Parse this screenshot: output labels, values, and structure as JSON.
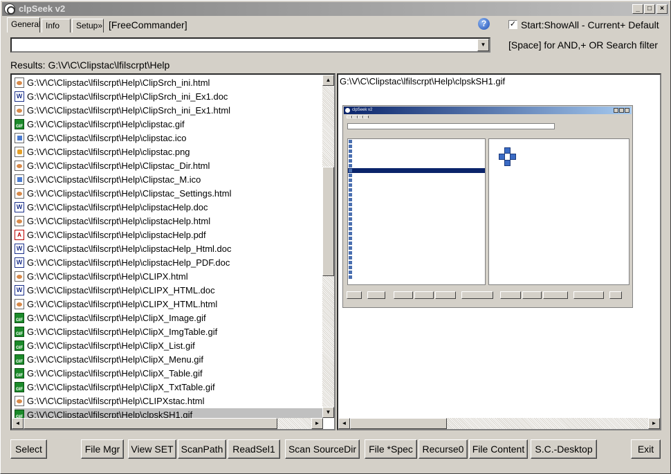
{
  "window": {
    "title": "clpSeek v2",
    "controls": {
      "minimize": "_",
      "maximize": "□",
      "close": "×"
    }
  },
  "tabs": [
    {
      "label": "General",
      "active": true
    },
    {
      "label": "Info",
      "active": false
    },
    {
      "label": "Setup»",
      "active": false
    }
  ],
  "freecommander_label": "[FreeCommander]",
  "help_icon": "?",
  "show_all": {
    "checked": true,
    "mark": "✓",
    "label": "Start:ShowAll - Current+ Default"
  },
  "search": {
    "value": "",
    "placeholder": "",
    "dropdown_glyph": "▼"
  },
  "filter_hint": "[Space] for AND,+ OR Search filter",
  "results_label": "Results: G:\\V\\C\\Clipstac\\lfilscrpt\\Help",
  "files": [
    {
      "path": "G:\\V\\C\\Clipstac\\lfilscrpt\\Help\\ClipSrch_ini.html",
      "icon": "html-file-icon",
      "type": "html"
    },
    {
      "path": "G:\\V\\C\\Clipstac\\lfilscrpt\\Help\\ClipSrch_ini_Ex1.doc",
      "icon": "word-doc-icon",
      "type": "doc"
    },
    {
      "path": "G:\\V\\C\\Clipstac\\lfilscrpt\\Help\\ClipSrch_ini_Ex1.html",
      "icon": "html-file-icon",
      "type": "html"
    },
    {
      "path": "G:\\V\\C\\Clipstac\\lfilscrpt\\Help\\clipstac.gif",
      "icon": "gif-file-icon",
      "type": "gif"
    },
    {
      "path": "G:\\V\\C\\Clipstac\\lfilscrpt\\Help\\clipstac.ico",
      "icon": "ico-file-icon",
      "type": "ico"
    },
    {
      "path": "G:\\V\\C\\Clipstac\\lfilscrpt\\Help\\clipstac.png",
      "icon": "png-file-icon",
      "type": "png"
    },
    {
      "path": "G:\\V\\C\\Clipstac\\lfilscrpt\\Help\\Clipstac_Dir.html",
      "icon": "html-file-icon",
      "type": "html"
    },
    {
      "path": "G:\\V\\C\\Clipstac\\lfilscrpt\\Help\\Clipstac_M.ico",
      "icon": "ico-file-icon",
      "type": "ico"
    },
    {
      "path": "G:\\V\\C\\Clipstac\\lfilscrpt\\Help\\Clipstac_Settings.html",
      "icon": "html-file-icon",
      "type": "html"
    },
    {
      "path": "G:\\V\\C\\Clipstac\\lfilscrpt\\Help\\clipstacHelp.doc",
      "icon": "word-doc-icon",
      "type": "doc"
    },
    {
      "path": "G:\\V\\C\\Clipstac\\lfilscrpt\\Help\\clipstacHelp.html",
      "icon": "html-file-icon",
      "type": "html"
    },
    {
      "path": "G:\\V\\C\\Clipstac\\lfilscrpt\\Help\\clipstacHelp.pdf",
      "icon": "pdf-file-icon",
      "type": "pdf"
    },
    {
      "path": "G:\\V\\C\\Clipstac\\lfilscrpt\\Help\\clipstacHelp_Html.doc",
      "icon": "word-doc-icon",
      "type": "doc"
    },
    {
      "path": "G:\\V\\C\\Clipstac\\lfilscrpt\\Help\\clipstacHelp_PDF.doc",
      "icon": "word-doc-icon",
      "type": "doc"
    },
    {
      "path": "G:\\V\\C\\Clipstac\\lfilscrpt\\Help\\CLIPX.html",
      "icon": "html-file-icon",
      "type": "html"
    },
    {
      "path": "G:\\V\\C\\Clipstac\\lfilscrpt\\Help\\CLIPX_HTML.doc",
      "icon": "word-doc-icon",
      "type": "doc"
    },
    {
      "path": "G:\\V\\C\\Clipstac\\lfilscrpt\\Help\\CLIPX_HTML.html",
      "icon": "html-file-icon",
      "type": "html"
    },
    {
      "path": "G:\\V\\C\\Clipstac\\lfilscrpt\\Help\\ClipX_Image.gif",
      "icon": "gif-file-icon",
      "type": "gif"
    },
    {
      "path": "G:\\V\\C\\Clipstac\\lfilscrpt\\Help\\ClipX_ImgTable.gif",
      "icon": "gif-file-icon",
      "type": "gif"
    },
    {
      "path": "G:\\V\\C\\Clipstac\\lfilscrpt\\Help\\ClipX_List.gif",
      "icon": "gif-file-icon",
      "type": "gif"
    },
    {
      "path": "G:\\V\\C\\Clipstac\\lfilscrpt\\Help\\ClipX_Menu.gif",
      "icon": "gif-file-icon",
      "type": "gif"
    },
    {
      "path": "G:\\V\\C\\Clipstac\\lfilscrpt\\Help\\ClipX_Table.gif",
      "icon": "gif-file-icon",
      "type": "gif"
    },
    {
      "path": "G:\\V\\C\\Clipstac\\lfilscrpt\\Help\\ClipX_TxtTable.gif",
      "icon": "gif-file-icon",
      "type": "gif"
    },
    {
      "path": "G:\\V\\C\\Clipstac\\lfilscrpt\\Help\\CLIPXstac.html",
      "icon": "html-file-icon",
      "type": "html"
    },
    {
      "path": "G:\\V\\C\\Clipstac\\lfilscrpt\\Help\\clpskSH1.gif",
      "icon": "gif-file-icon",
      "type": "gif",
      "selected": true
    }
  ],
  "preview": {
    "path": "G:\\V\\C\\Clipstac\\lfilscrpt\\Help\\clpskSH1.gif"
  },
  "buttons": [
    {
      "label": "Select",
      "name": "select-button"
    },
    {
      "label": "File Mgr",
      "name": "file-mgr-button"
    },
    {
      "label": "View SET",
      "name": "view-set-button"
    },
    {
      "label": "ScanPath",
      "name": "scan-path-button"
    },
    {
      "label": "ReadSel1",
      "name": "read-sel1-button"
    },
    {
      "label": "Scan SourceDir",
      "name": "scan-sourcedir-button"
    },
    {
      "label": "File *Spec",
      "name": "file-spec-button"
    },
    {
      "label": "Recurse0",
      "name": "recurse0-button"
    },
    {
      "label": "File Content",
      "name": "file-content-button"
    },
    {
      "label": "S.C.-Desktop",
      "name": "sc-desktop-button"
    },
    {
      "label": "Exit",
      "name": "exit-button"
    }
  ],
  "scroll_glyphs": {
    "up": "▲",
    "down": "▼",
    "left": "◄",
    "right": "►"
  }
}
